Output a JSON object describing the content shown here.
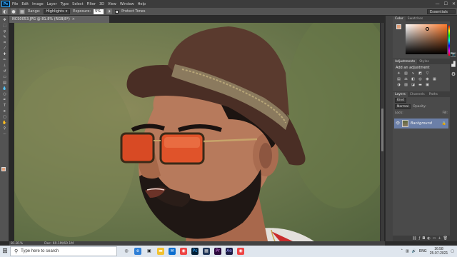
{
  "app": {
    "logo_text": "Ps",
    "menu": [
      "File",
      "Edit",
      "Image",
      "Layer",
      "Type",
      "Select",
      "Filter",
      "3D",
      "View",
      "Window",
      "Help"
    ],
    "window_controls": [
      "—",
      "☐",
      "✕"
    ]
  },
  "options": {
    "range_label": "Range:",
    "range_value": "Highlights",
    "exposure_label": "Exposure:",
    "exposure_value": "5%",
    "protect_tones": "Protect Tones",
    "workspace": "Essentials"
  },
  "document": {
    "tab_title": "NCS0053.JPG @ 81.8% (RGB/8*)",
    "close_glyph": "×",
    "zoom_status": "81.81%",
    "doc_status": "Doc: 69.1M/69.1M"
  },
  "color_panel": {
    "tabs": [
      "Color",
      "Swatches"
    ],
    "foreground": "#e2a07a",
    "hue_color": "#ff7a2a"
  },
  "adjustments_panel": {
    "tabs": [
      "Adjustments",
      "Styles"
    ],
    "title": "Add an adjustment"
  },
  "layers_panel": {
    "tabs": [
      "Layers",
      "Channels",
      "Paths"
    ],
    "kind": "Kind",
    "blend_mode": "Normal",
    "opacity_label": "Opacity:",
    "lock_label": "Lock:",
    "fill_label": "Fill:",
    "layers": [
      {
        "name": "Background",
        "visible": true,
        "locked": true
      }
    ]
  },
  "taskbar": {
    "search_placeholder": "Type here to search",
    "language": "ENG",
    "time": "16:58",
    "date": "25-07-2021"
  }
}
